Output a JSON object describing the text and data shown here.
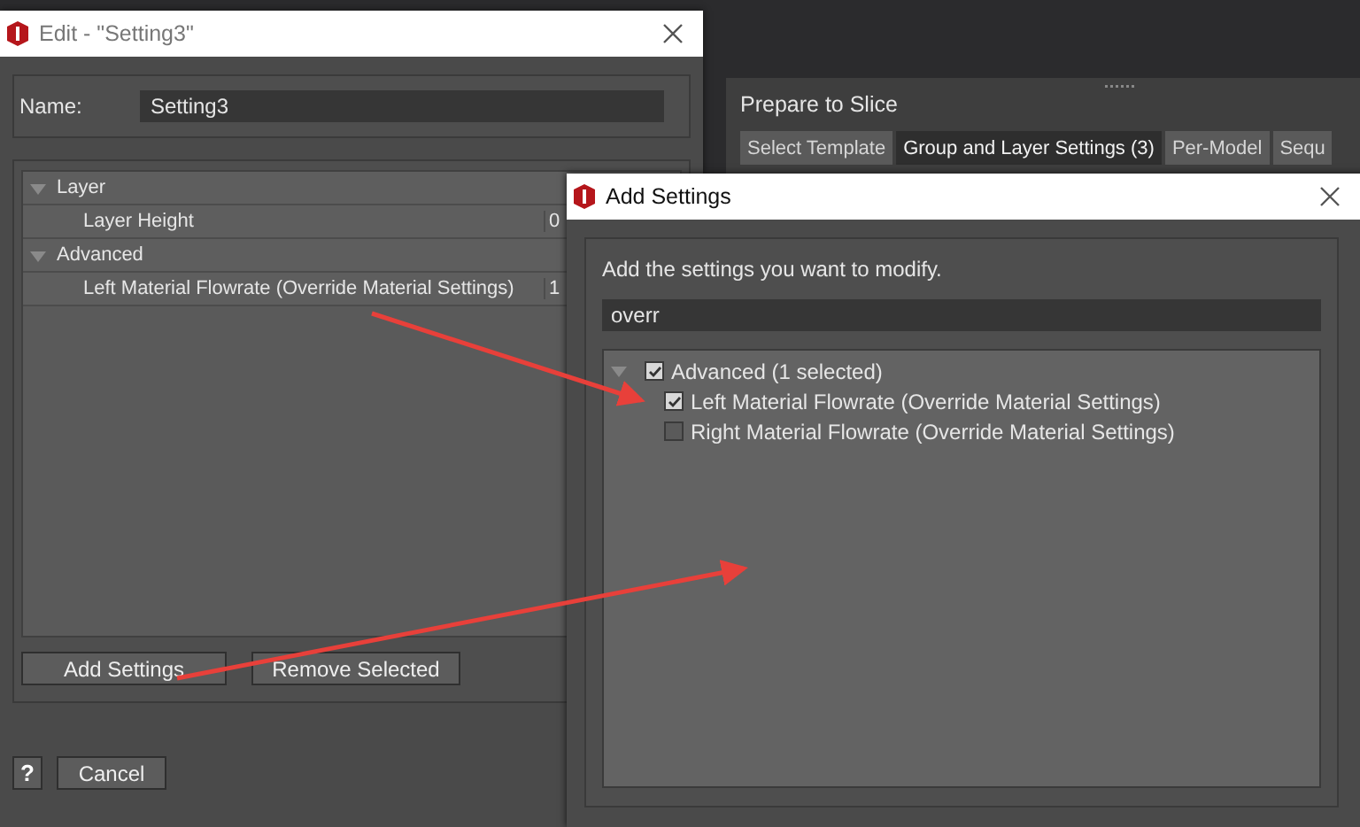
{
  "edit_dialog": {
    "title": "Edit - \"Setting3\"",
    "name_label": "Name:",
    "name_value": "Setting3",
    "tree": [
      {
        "label": "Layer",
        "expanded": true,
        "children": [
          {
            "label": "Layer Height",
            "value": "0"
          }
        ]
      },
      {
        "label": "Advanced",
        "expanded": true,
        "children": [
          {
            "label": "Left Material Flowrate (Override Material Settings)",
            "value": "1"
          }
        ]
      }
    ],
    "buttons": [
      "Add Settings",
      "Remove Selected"
    ],
    "help": "?",
    "cancel": "Cancel"
  },
  "slice_panel": {
    "title": "Prepare to Slice",
    "tabs": [
      {
        "label": "Select Template",
        "selected": false
      },
      {
        "label": "Group and Layer Settings (3)",
        "selected": true
      },
      {
        "label": "Per-Model",
        "selected": false
      },
      {
        "label": "Sequ",
        "selected": false
      }
    ]
  },
  "add_dialog": {
    "title": "Add Settings",
    "instruction": "Add the settings you want to modify.",
    "search": "overr",
    "groups": [
      {
        "label": "Advanced (1 selected)",
        "expanded": true,
        "checked": true,
        "children": [
          {
            "label": "Left Material Flowrate (Override Material Settings)",
            "checked": true
          },
          {
            "label": "Right Material Flowrate (Override Material Settings)",
            "checked": false
          }
        ]
      }
    ]
  }
}
